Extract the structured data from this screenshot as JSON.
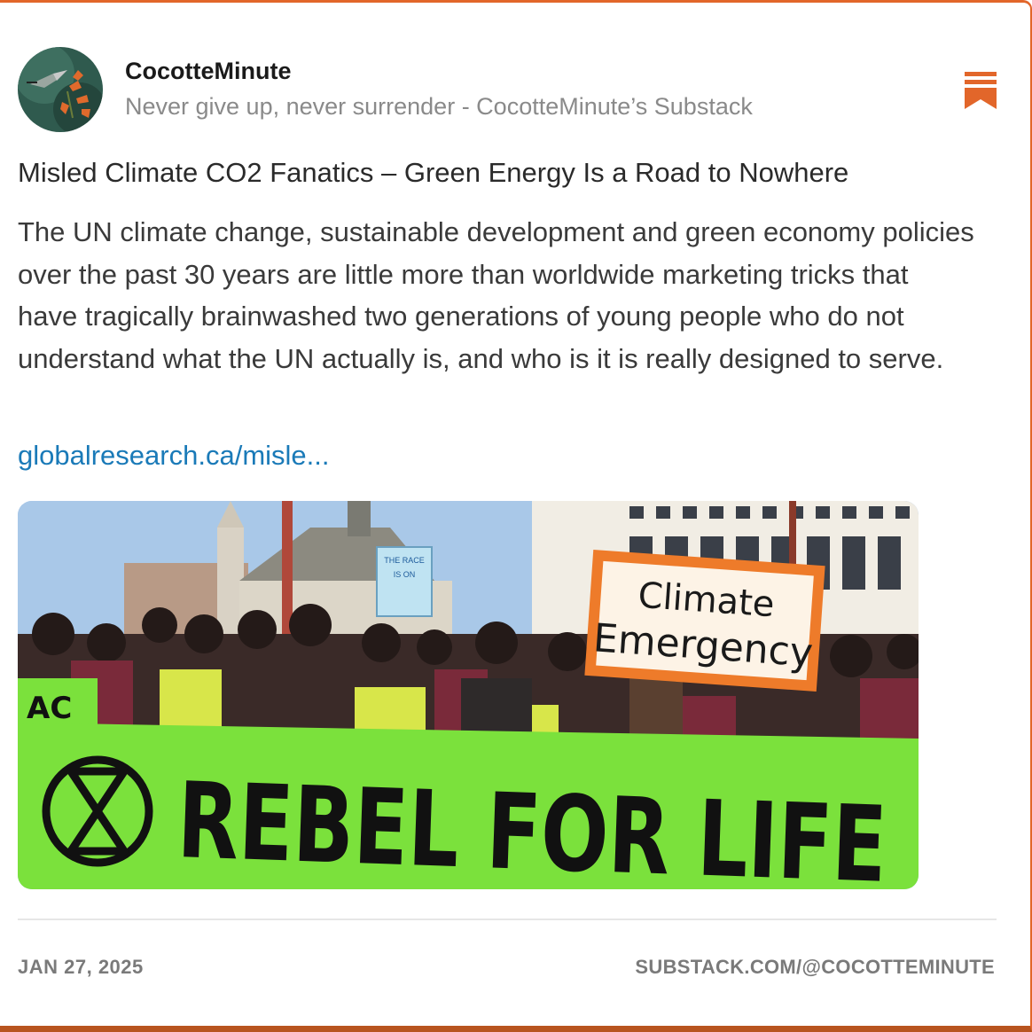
{
  "post": {
    "author": "CocotteMinute",
    "subtitle": "Never give up, never surrender - CocotteMinute’s Substack",
    "title": "Misled Climate CO2 Fanatics – Green Energy Is a Road to Nowhere",
    "body": "The UN climate change, sustainable development and green economy policies over the past 30 years are little more than worldwide marketing tricks that have tragically brainwashed two generations of young people who do not understand what the UN actually is, and who is it is really designed to serve.",
    "link": "globalresearch.ca/misle...",
    "date": "JAN 27, 2025",
    "source": "SUBSTACK.COM/@COCOTTEMINUTE"
  },
  "image": {
    "banner_text": "REBEL FOR LIFE",
    "sign_line1": "Climate",
    "sign_line2": "Emergency",
    "small_sign_text": "THE RACE IS ON"
  },
  "icons": {
    "avatar": "hummingbird-avatar-icon",
    "bookmark": "substack-bookmark-icon"
  },
  "colors": {
    "accent": "#e2662a",
    "link": "#1a7ab8",
    "banner": "#7be13c"
  }
}
